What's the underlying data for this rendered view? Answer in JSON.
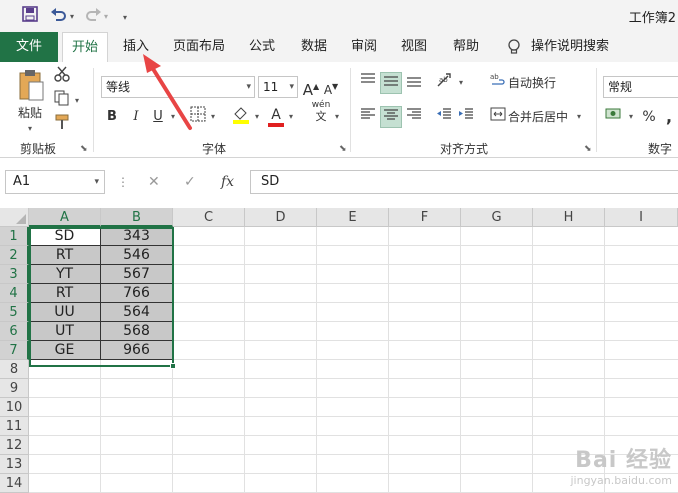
{
  "title_bar": {
    "title": "工作簿2"
  },
  "tabs": [
    {
      "label": "文件"
    },
    {
      "label": "开始"
    },
    {
      "label": "插入"
    },
    {
      "label": "页面布局"
    },
    {
      "label": "公式"
    },
    {
      "label": "数据"
    },
    {
      "label": "审阅"
    },
    {
      "label": "视图"
    },
    {
      "label": "帮助"
    },
    {
      "label": "操作说明搜索"
    }
  ],
  "ribbon": {
    "clipboard": {
      "paste_label": "粘贴",
      "group_label": "剪贴板"
    },
    "font": {
      "font_name": "等线",
      "font_size": "11",
      "bold": "B",
      "italic": "I",
      "underline": "U",
      "font_color_glyph": "A",
      "phonetic_glyph": "wén",
      "phonetic_sub": "文",
      "grow_glyph": "A",
      "shrink_glyph": "A",
      "group_label": "字体"
    },
    "alignment": {
      "wrap_text": "自动换行",
      "merge_center": "合并后居中",
      "group_label": "对齐方式"
    },
    "number": {
      "format": "常规",
      "percent": "%",
      "comma": ",",
      "group_label": "数字"
    }
  },
  "formula_bar": {
    "name_box": "A1",
    "fx": "fx",
    "content": "SD"
  },
  "sheet": {
    "columns": [
      "A",
      "B",
      "C",
      "D",
      "E",
      "F",
      "G",
      "H",
      "I"
    ],
    "rows": [
      "1",
      "2",
      "3",
      "4",
      "5",
      "6",
      "7",
      "8",
      "9",
      "10",
      "11",
      "12",
      "13",
      "14"
    ],
    "data": [
      [
        "SD",
        "343"
      ],
      [
        "RT",
        "546"
      ],
      [
        "YT",
        "567"
      ],
      [
        "RT",
        "766"
      ],
      [
        "UU",
        "564"
      ],
      [
        "UT",
        "568"
      ],
      [
        "GE",
        "966"
      ]
    ]
  },
  "watermark": {
    "main": "Bai 经验",
    "sub": "jingyan.baidu.com"
  },
  "colors": {
    "excel_green": "#217346",
    "annotation_red": "#e84545",
    "cell_fill": "#c8c8c8"
  }
}
